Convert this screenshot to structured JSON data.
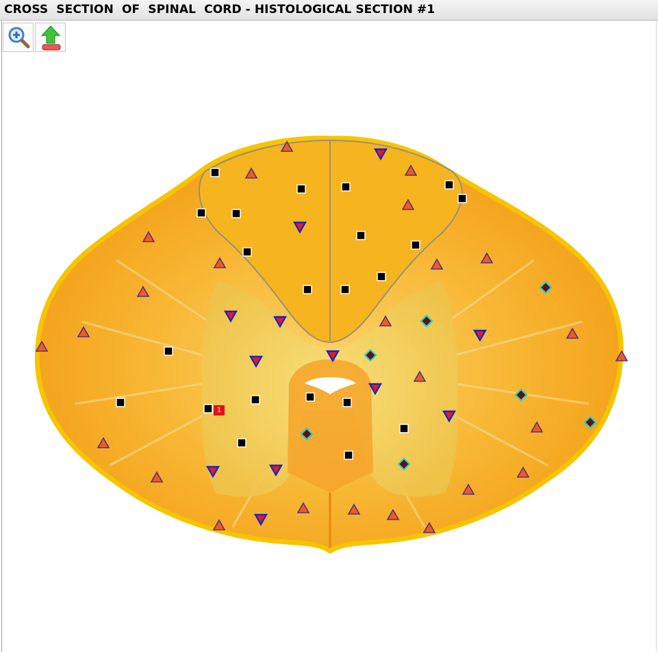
{
  "window": {
    "title": "CROSS  SECTION  OF  SPINAL  CORD - HISTOLOGICAL SECTION #1"
  },
  "toolbar": {
    "buttons": [
      {
        "name": "zoom-in-button",
        "icon": "magnifier-plus-icon"
      },
      {
        "name": "export-button",
        "icon": "green-up-arrow-icon"
      }
    ]
  },
  "image": {
    "section_label": "1"
  },
  "colors": {
    "tissue_outer": "#f5a100",
    "tissue_mid": "#f7b531",
    "gray_matter": "#f2d55e",
    "dorsal_column": "#f6b41e",
    "triangle_fill": "#e8601c",
    "triangle_stroke": "#5b2a8e",
    "inverted_fill": "#dd1f1f",
    "inverted_stroke": "#1d22c8",
    "square_fill": "#000000",
    "diamond_fill": "#6b0d0d",
    "diamond_stroke": "#19d4d6",
    "label_bg": "#e01414"
  }
}
